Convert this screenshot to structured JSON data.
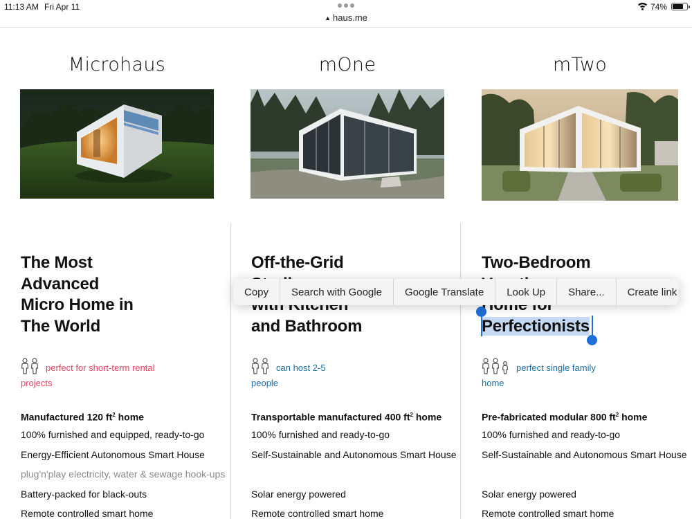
{
  "status_bar": {
    "time": "11:13 AM",
    "date": "Fri Apr 11",
    "url": "haus.me",
    "battery_percent": "74%",
    "battery_level": 0.74,
    "icons": [
      "lock-icon",
      "wifi-icon",
      "battery-icon"
    ]
  },
  "colors": {
    "pink_accent": "#e0455f",
    "blue_accent": "#1e6e9e",
    "selection": "#c5d9f2",
    "handle_blue": "#1f6fd6"
  },
  "columns": [
    {
      "title": "Microhaus",
      "headline_lines": [
        "The Most",
        "Advanced",
        "Micro Home in",
        "The World"
      ],
      "badge_text": "perfect for short-term rental projects",
      "badge_line1": "perfect for short-term rental",
      "badge_line2": "projects",
      "people_icon_count": 2,
      "features": [
        {
          "text": "Manufactured 120 ft",
          "sup": "2",
          "tail": " home"
        },
        {
          "text": "100% furnished and equipped, ready-to-go"
        },
        {
          "text": "Energy-Efficient Autonomous Smart House"
        },
        {
          "text": "plug'n'play electricity, water & sewage hook-ups"
        },
        {
          "text": "Battery-packed for black-outs"
        },
        {
          "text": "Remote controlled smart home"
        }
      ]
    },
    {
      "title": "mOne",
      "headline_lines": [
        "Off-the-Grid",
        "Studio",
        "with Kitchen",
        "and Bathroom"
      ],
      "badge_text": "can host 2-5 people",
      "badge_line1": "can host 2-5",
      "badge_line2": "people",
      "people_icon_count": 2,
      "features": [
        {
          "text": "Transportable manufactured 400 ft",
          "sup": "2",
          "tail": " home"
        },
        {
          "text": "100% furnished and ready-to-go"
        },
        {
          "text": "Self-Sustainable and Autonomous Smart House"
        },
        {
          "text": ""
        },
        {
          "text": "Solar energy powered"
        },
        {
          "text": "Remote controlled smart home"
        }
      ]
    },
    {
      "title": "mTwo",
      "headline_lines": [
        "Two-Bedroom",
        "Vacation",
        "Home for",
        "Perfectionists"
      ],
      "badge_text": "perfect single family home",
      "badge_line1": "perfect single family",
      "badge_line2": "home",
      "people_icon_count": 3,
      "features": [
        {
          "text": "Pre-fabricated modular 800 ft",
          "sup": "2",
          "tail": " home"
        },
        {
          "text": "100% furnished and ready-to-go"
        },
        {
          "text": "Self-Sustainable and Autonomous Smart House"
        },
        {
          "text": ""
        },
        {
          "text": "Solar energy powered"
        },
        {
          "text": "Remote controlled smart home"
        }
      ]
    }
  ],
  "context_menu": {
    "items": [
      "Copy",
      "Search with Google",
      "Google Translate",
      "Look Up",
      "Share...",
      "Create link"
    ]
  },
  "selected_text": "Perfectionists"
}
